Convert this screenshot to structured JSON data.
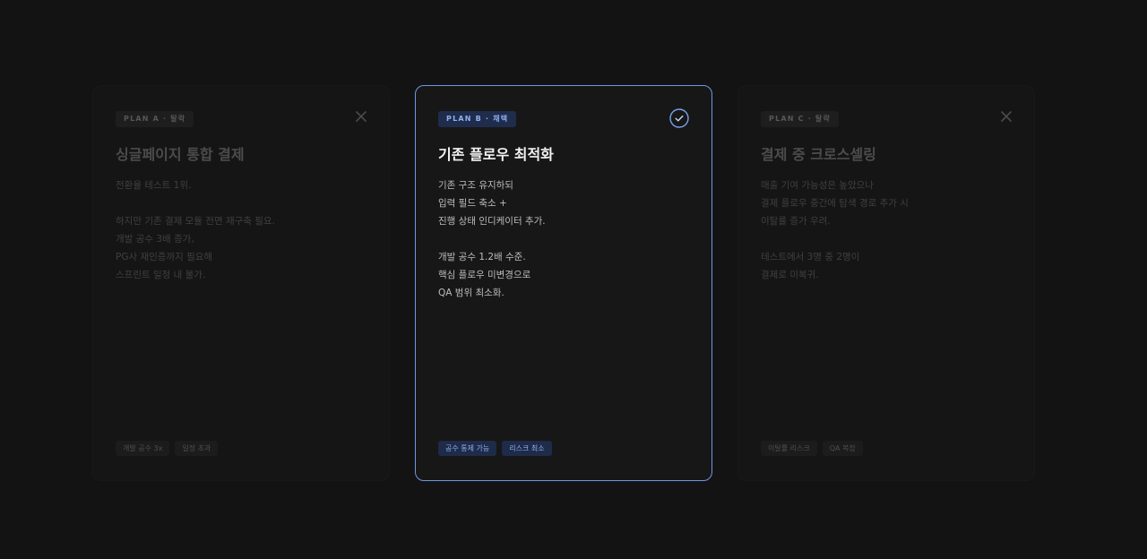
{
  "cards": [
    {
      "badge": "PLAN A · 탈락",
      "title": "싱글페이지 통합 결제",
      "lines": [
        "전환율 테스트 1위.",
        "",
        "하지만 기존 결제 모듈 전면 재구축 필요.",
        "개발 공수 3배 증가,",
        "PG사 재인증까지 필요해",
        "스프린트 일정 내 불가."
      ],
      "tags": [
        "개발 공수 3x",
        "일정 초과"
      ],
      "status": "dropped",
      "icon": "close-icon"
    },
    {
      "badge": "PLAN B · 채택",
      "title": "기존 플로우 최적화",
      "lines": [
        "기존 구조 유지하되",
        "입력 필드 축소 +",
        "진행 상태 인디케이터 추가.",
        "",
        "개발 공수 1.2배 수준.",
        "핵심 플로우 미변경으로",
        "QA 범위 최소화."
      ],
      "tags": [
        "공수 통제 가능",
        "리스크 최소"
      ],
      "status": "chosen",
      "icon": "check-circle-icon"
    },
    {
      "badge": "PLAN C · 탈락",
      "title": "결제 중 크로스셀링",
      "lines": [
        "매출 기여 가능성은 높았으나",
        "결제 플로우 중간에 탐색 경로 추가 시",
        "이탈률 증가 우려.",
        "",
        "테스트에서 3명 중 2명이",
        "결제로 미복귀."
      ],
      "tags": [
        "이탈률 리스크",
        "QA 복잡"
      ],
      "status": "dropped",
      "icon": "close-icon"
    }
  ],
  "colors": {
    "background": "#131313",
    "accent": "#6f96e4",
    "card": "#1a1a1a"
  }
}
